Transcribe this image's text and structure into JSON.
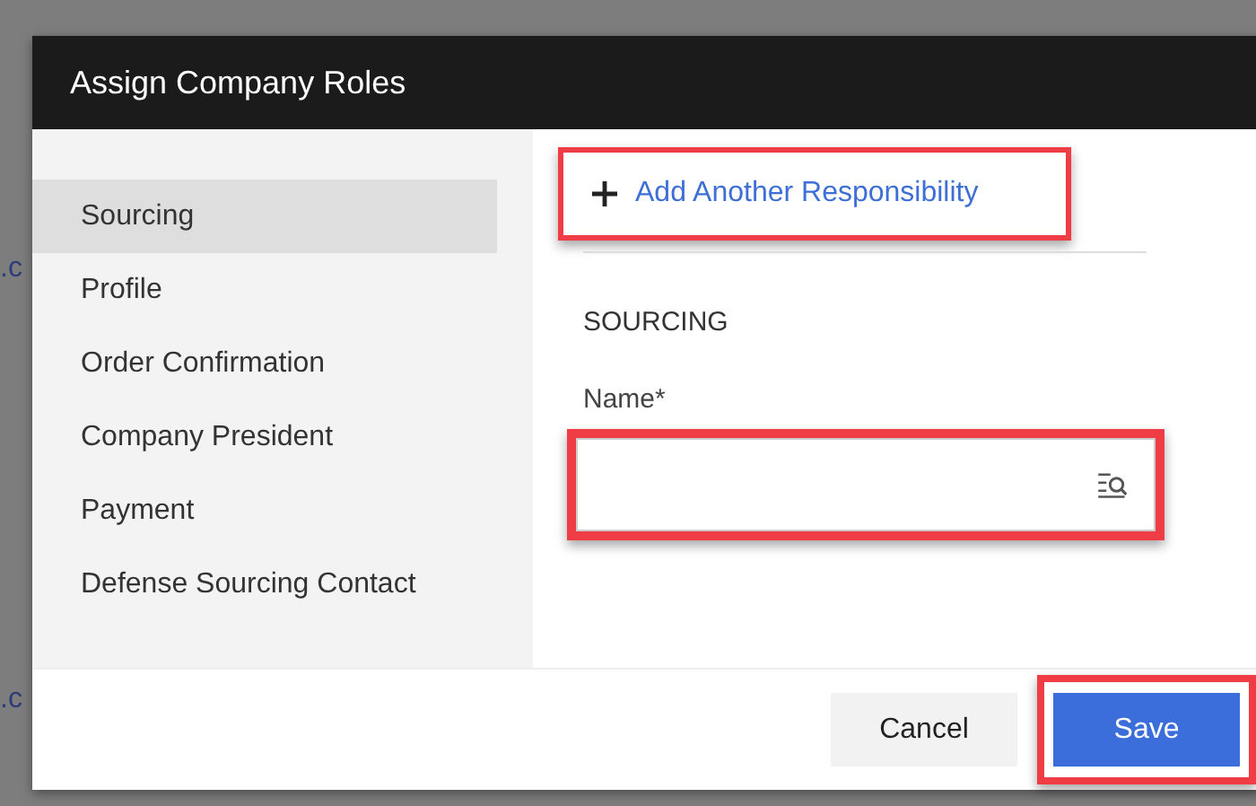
{
  "background_fragments": [
    ".c",
    ".c"
  ],
  "dialog": {
    "title": "Assign Company Roles"
  },
  "sidebar": {
    "items": [
      {
        "label": "Sourcing",
        "selected": true
      },
      {
        "label": "Profile",
        "selected": false
      },
      {
        "label": "Order Confirmation",
        "selected": false
      },
      {
        "label": "Company President",
        "selected": false
      },
      {
        "label": "Payment",
        "selected": false
      },
      {
        "label": "Defense Sourcing Contact",
        "selected": false
      }
    ]
  },
  "content": {
    "add_link": {
      "label": "Add Another Responsibility",
      "highlighted": true
    },
    "section_title": "SOURCING",
    "name_field": {
      "label": "Name*",
      "highlighted": true
    }
  },
  "footer": {
    "buttons": [
      {
        "label": "Cancel",
        "kind": "secondary"
      },
      {
        "label": "Save",
        "kind": "primary",
        "highlighted": true
      }
    ]
  }
}
